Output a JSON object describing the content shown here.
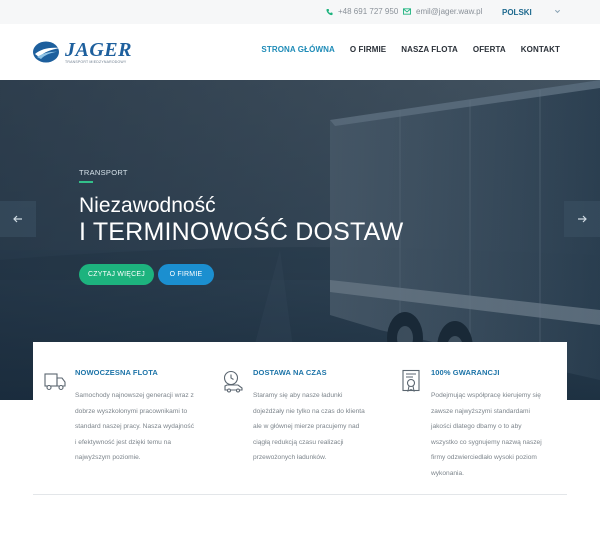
{
  "topbar": {
    "phone": "+48 691 727 950",
    "email": "emil@jager.waw.pl",
    "language": "POLSKI"
  },
  "header": {
    "brand": "JAGER",
    "tagline": "TRANSPORT MIEDZYNARODOWY"
  },
  "nav": {
    "items": [
      {
        "label": "STRONA GŁÓWNA",
        "active": true
      },
      {
        "label": "O FIRMIE"
      },
      {
        "label": "NASZA FLOTA"
      },
      {
        "label": "OFERTA"
      },
      {
        "label": "KONTAKT"
      }
    ]
  },
  "hero": {
    "kicker": "TRANSPORT",
    "headline1": "Niezawodność",
    "headline2": "I TERMINOWOŚĆ DOSTAW",
    "btn_primary": "CZYTAJ WIĘCEJ",
    "btn_secondary": "O FIRMIE"
  },
  "features": [
    {
      "icon": "truck-icon",
      "title": "NOWOCZESNA FLOTA",
      "body": "Samochody najnowszej generacji wraz z dobrze wyszkolonymi pracownikami to standard naszej pracy. Nasza wydajność i efektywność jest dzięki temu na najwyższym poziomie."
    },
    {
      "icon": "delivery-clock-icon",
      "title": "DOSTAWA NA CZAS",
      "body": "Staramy się aby nasze ładunki dojeżdżały nie tylko na czas do klienta ale w głównej mierze pracujemy nad ciągłą redukcją czasu realizacji przewożonych ładunków."
    },
    {
      "icon": "certificate-icon",
      "title": "100% GWARANCJI",
      "body": "Podejmując współpracę kierujemy się zawsze najwyższymi standardami jakości dlatego dbamy o to aby wszystko co sygnujemy nazwą naszej firmy odzwierciedlało wysoki poziom wykonania."
    }
  ],
  "colors": {
    "accent": "#1e8bb7",
    "brand": "#1d5f9d",
    "green": "#1db37e",
    "blue": "#1b8fd0"
  }
}
